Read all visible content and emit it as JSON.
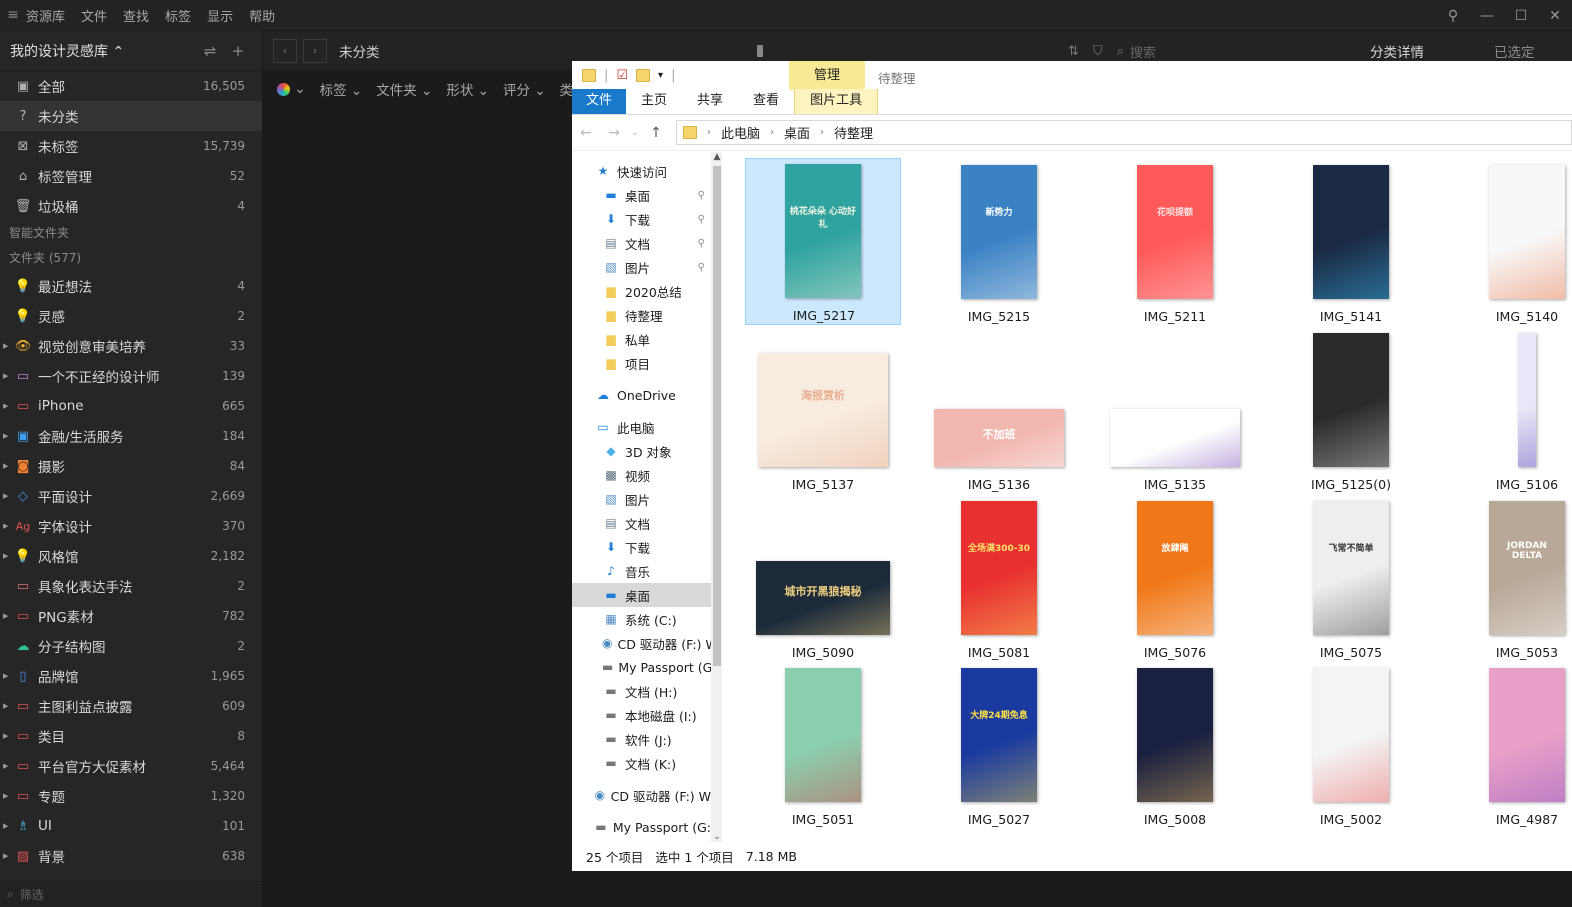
{
  "menubar": {
    "items": [
      "资源库",
      "文件",
      "查找",
      "标签",
      "显示",
      "帮助"
    ]
  },
  "library": {
    "name": "我的设计灵感库 ⌃"
  },
  "sidebar": {
    "top_items": [
      {
        "label": "全部",
        "count": "16,505",
        "icon": "image-icon"
      },
      {
        "label": "未分类",
        "count": "",
        "icon": "question-icon"
      },
      {
        "label": "未标签",
        "count": "15,739",
        "icon": "untagged-icon"
      },
      {
        "label": "标签管理",
        "count": "52",
        "icon": "tag-icon"
      },
      {
        "label": "垃圾桶",
        "count": "4",
        "icon": "trash-icon"
      }
    ],
    "smart_folders_title": "智能文件夹",
    "folders_title": "文件夹 (577)",
    "folders": [
      {
        "label": "最近想法",
        "count": "4",
        "color": "#b38af0",
        "glyph": "💡"
      },
      {
        "label": "灵感",
        "count": "2",
        "color": "#f0c040",
        "glyph": "💡"
      },
      {
        "label": "视觉创意审美培养",
        "count": "33",
        "color": "#f0b030",
        "glyph": "👁"
      },
      {
        "label": "一个不正经的设计师",
        "count": "139",
        "color": "#c080e0",
        "glyph": "▭"
      },
      {
        "label": "iPhone",
        "count": "665",
        "color": "#e05050",
        "glyph": "▭"
      },
      {
        "label": "金融/生活服务",
        "count": "184",
        "color": "#40a0f0",
        "glyph": "▣"
      },
      {
        "label": "摄影",
        "count": "84",
        "color": "#f08030",
        "glyph": "◙"
      },
      {
        "label": "平面设计",
        "count": "2,669",
        "color": "#4090f0",
        "glyph": "◇"
      },
      {
        "label": "字体设计",
        "count": "370",
        "color": "#e05050",
        "glyph": "Ag"
      },
      {
        "label": "风格馆",
        "count": "2,182",
        "color": "#f0c040",
        "glyph": "💡"
      },
      {
        "label": "具象化表达手法",
        "count": "2",
        "color": "#e07070",
        "glyph": "▭"
      },
      {
        "label": "PNG素材",
        "count": "782",
        "color": "#e05050",
        "glyph": "▭"
      },
      {
        "label": "分子结构图",
        "count": "2",
        "color": "#30c0a0",
        "glyph": "☁"
      },
      {
        "label": "品牌馆",
        "count": "1,965",
        "color": "#4090f0",
        "glyph": "▯"
      },
      {
        "label": "主图利益点披露",
        "count": "609",
        "color": "#e05050",
        "glyph": "▭"
      },
      {
        "label": "类目",
        "count": "8",
        "color": "#e05050",
        "glyph": "▭"
      },
      {
        "label": "平台官方大促素材",
        "count": "5,464",
        "color": "#e05050",
        "glyph": "▭"
      },
      {
        "label": "专题",
        "count": "1,320",
        "color": "#e05050",
        "glyph": "▭"
      },
      {
        "label": "UI",
        "count": "101",
        "color": "#40b0e0",
        "glyph": "♗"
      },
      {
        "label": "背景",
        "count": "638",
        "color": "#e05050",
        "glyph": "▨"
      }
    ],
    "filter_placeholder": "筛选"
  },
  "main": {
    "breadcrumb": "未分类",
    "filters": [
      "标签",
      "文件夹",
      "形状",
      "评分",
      "类型"
    ],
    "search_placeholder": "搜索",
    "right_tabs": [
      "分类详情",
      "已选定"
    ]
  },
  "explorer": {
    "ribbon_context_tab": "管理",
    "window_title": "待整理",
    "tabs": [
      "文件",
      "主页",
      "共享",
      "查看"
    ],
    "context_tab": "图片工具",
    "path": [
      "此电脑",
      "桌面",
      "待整理"
    ],
    "nav": [
      {
        "label": "快速访问",
        "icon": "star-icon",
        "glyph": "★",
        "color": "#2a7fd4",
        "level": 1,
        "pin": false
      },
      {
        "label": "桌面",
        "icon": "desktop-icon",
        "glyph": "▬",
        "color": "#1f7fd8",
        "level": 2,
        "pin": true
      },
      {
        "label": "下载",
        "icon": "download-icon",
        "glyph": "⬇",
        "color": "#1f7fd8",
        "level": 2,
        "pin": true
      },
      {
        "label": "文档",
        "icon": "document-icon",
        "glyph": "▤",
        "color": "#6a7a8a",
        "level": 2,
        "pin": true
      },
      {
        "label": "图片",
        "icon": "picture-icon",
        "glyph": "▧",
        "color": "#4a8ac0",
        "level": 2,
        "pin": true
      },
      {
        "label": "2020总结",
        "icon": "folder-icon",
        "glyph": "▆",
        "color": "#f2cd5c",
        "level": 2,
        "pin": false
      },
      {
        "label": "待整理",
        "icon": "folder-icon",
        "glyph": "▆",
        "color": "#f2cd5c",
        "level": 2,
        "pin": false
      },
      {
        "label": "私单",
        "icon": "folder-icon",
        "glyph": "▆",
        "color": "#f2cd5c",
        "level": 2,
        "pin": false
      },
      {
        "label": "项目",
        "icon": "folder-icon",
        "glyph": "▆",
        "color": "#f2cd5c",
        "level": 2,
        "pin": false
      },
      {
        "gap": true
      },
      {
        "label": "OneDrive",
        "icon": "cloud-icon",
        "glyph": "☁",
        "color": "#1f7fd8",
        "level": 1,
        "pin": false
      },
      {
        "gap": true
      },
      {
        "label": "此电脑",
        "icon": "computer-icon",
        "glyph": "▭",
        "color": "#1f7fd8",
        "level": 1,
        "pin": false
      },
      {
        "label": "3D 对象",
        "icon": "cube-icon",
        "glyph": "◆",
        "color": "#4ab0e8",
        "level": 2,
        "pin": false
      },
      {
        "label": "视频",
        "icon": "video-icon",
        "glyph": "▩",
        "color": "#556677",
        "level": 2,
        "pin": false
      },
      {
        "label": "图片",
        "icon": "picture-icon",
        "glyph": "▧",
        "color": "#4a8ac0",
        "level": 2,
        "pin": false
      },
      {
        "label": "文档",
        "icon": "document-icon",
        "glyph": "▤",
        "color": "#6a7a8a",
        "level": 2,
        "pin": false
      },
      {
        "label": "下载",
        "icon": "download-icon",
        "glyph": "⬇",
        "color": "#1f7fd8",
        "level": 2,
        "pin": false
      },
      {
        "label": "音乐",
        "icon": "music-icon",
        "glyph": "♪",
        "color": "#1f7fd8",
        "level": 2,
        "pin": false
      },
      {
        "label": "桌面",
        "icon": "desktop-icon",
        "glyph": "▬",
        "color": "#1f7fd8",
        "level": 2,
        "pin": false,
        "selected": true
      },
      {
        "label": "系统 (C:)",
        "icon": "drive-icon",
        "glyph": "▦",
        "color": "#4a8ac0",
        "level": 2,
        "pin": false
      },
      {
        "label": "CD 驱动器 (F:) W",
        "icon": "cd-icon",
        "glyph": "◉",
        "color": "#4a8ac0",
        "level": 2,
        "pin": false
      },
      {
        "label": "My Passport (G",
        "icon": "drive-icon",
        "glyph": "▬",
        "color": "#777",
        "level": 2,
        "pin": false
      },
      {
        "label": "文档 (H:)",
        "icon": "drive-icon",
        "glyph": "▬",
        "color": "#777",
        "level": 2,
        "pin": false
      },
      {
        "label": "本地磁盘 (I:)",
        "icon": "drive-icon",
        "glyph": "▬",
        "color": "#777",
        "level": 2,
        "pin": false
      },
      {
        "label": "软件 (J:)",
        "icon": "drive-icon",
        "glyph": "▬",
        "color": "#777",
        "level": 2,
        "pin": false
      },
      {
        "label": "文档 (K:)",
        "icon": "drive-icon",
        "glyph": "▬",
        "color": "#777",
        "level": 2,
        "pin": false
      },
      {
        "gap": true
      },
      {
        "label": "CD 驱动器 (F:) W",
        "icon": "cd-icon",
        "glyph": "◉",
        "color": "#4a8ac0",
        "level": 1,
        "pin": false
      },
      {
        "gap": true
      },
      {
        "label": "My Passport (G:",
        "icon": "drive-icon",
        "glyph": "▬",
        "color": "#777",
        "level": 1,
        "pin": false
      }
    ],
    "files": [
      {
        "name": "IMG_5217",
        "selected": true,
        "shape": "tall",
        "bg": "#2fa3a0",
        "accent": "#f0f4e0",
        "text": "桃花朵朵 心动好礼"
      },
      {
        "name": "IMG_5215",
        "shape": "tall",
        "bg": "#3b82c4",
        "accent": "#ffffff",
        "text": "新势力"
      },
      {
        "name": "IMG_5211",
        "shape": "tall",
        "bg": "#ff5a5a",
        "accent": "#ffe0e0",
        "text": "花呗提额"
      },
      {
        "name": "IMG_5141",
        "shape": "tall",
        "bg": "#1a2a44",
        "accent": "#3ec6ff",
        "text": ""
      },
      {
        "name": "IMG_5140",
        "shape": "tall",
        "bg": "#f8f8f8",
        "accent": "#e86a3a",
        "text": ""
      },
      {
        "name": "IMG_5137",
        "shape": "wide",
        "bg": "#f8ece0",
        "accent": "#e8b090",
        "text": "海报赏析"
      },
      {
        "name": "IMG_5136",
        "shape": "short",
        "bg": "#f2b8b0",
        "accent": "#ffffff",
        "text": "不加班"
      },
      {
        "name": "IMG_5135",
        "shape": "short",
        "bg": "#ffffff",
        "accent": "#7a4ab8",
        "text": ""
      },
      {
        "name": "IMG_5125(0)",
        "shape": "tall",
        "bg": "#2a2a2a",
        "accent": "#e0e0e0",
        "text": ""
      },
      {
        "name": "IMG_5106",
        "shape": "narrow",
        "bg": "#e8e8f8",
        "accent": "#5a4ab8",
        "text": ""
      },
      {
        "name": "IMG_5090",
        "shape": "wide2",
        "bg": "#1c2a3a",
        "accent": "#f0d080",
        "text": "城市开黑狼揭秘"
      },
      {
        "name": "IMG_5081",
        "shape": "tall",
        "bg": "#e83030",
        "accent": "#ffe066",
        "text": "全场满300-30"
      },
      {
        "name": "IMG_5076",
        "shape": "tall",
        "bg": "#f07818",
        "accent": "#ffffff",
        "text": "放肆飚"
      },
      {
        "name": "IMG_5075",
        "shape": "tall",
        "bg": "#eeeeee",
        "accent": "#333333",
        "text": "飞常不简单"
      },
      {
        "name": "IMG_5053",
        "shape": "tall",
        "bg": "#b8a898",
        "accent": "#ffffff",
        "text": "JORDAN DELTA"
      },
      {
        "name": "IMG_5051",
        "shape": "tall",
        "bg": "#8ad0b0",
        "accent": "#d84040",
        "text": ""
      },
      {
        "name": "IMG_5027",
        "shape": "tall",
        "bg": "#1a3aa0",
        "accent": "#ffe040",
        "text": "大牌24期免息"
      },
      {
        "name": "IMG_5008",
        "shape": "tall",
        "bg": "#1a2040",
        "accent": "#f0c060",
        "text": ""
      },
      {
        "name": "IMG_5002",
        "shape": "tall",
        "bg": "#f4f4f4",
        "accent": "#e85050",
        "text": ""
      },
      {
        "name": "IMG_4987",
        "shape": "tall",
        "bg": "#e8a0c8",
        "accent": "#8a50c0",
        "text": ""
      }
    ],
    "status": {
      "count": "25 个项目",
      "selected": "选中 1 个项目",
      "size": "7.18 MB"
    }
  }
}
